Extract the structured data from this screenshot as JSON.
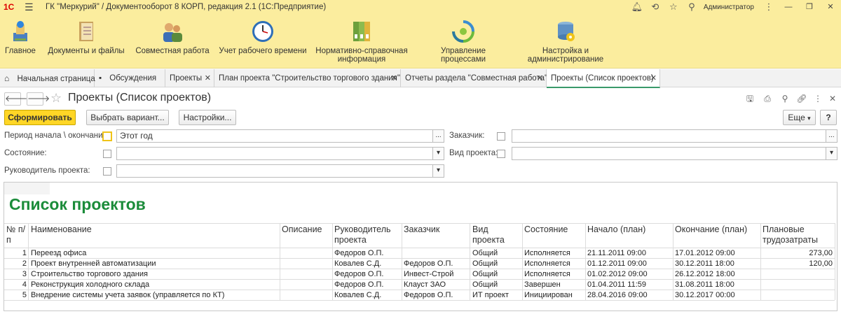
{
  "titlebar": {
    "logo": "1С",
    "title": "ГК \"Меркурий\" / Документооборот 8 КОРП, редакция 2.1  (1С:Предприятие)",
    "user": "Администратор",
    "icons": [
      "bell-icon",
      "history-icon",
      "star-icon",
      "search-icon",
      "dots-icon"
    ]
  },
  "sections": [
    {
      "label": "Главное",
      "icon": "home-icon"
    },
    {
      "label": "Документы и файлы",
      "icon": "documents-icon"
    },
    {
      "label": "Совместная работа",
      "icon": "people-icon"
    },
    {
      "label": "Учет рабочего времени",
      "icon": "clock-icon"
    },
    {
      "label": "Нормативно-справочная информация",
      "icon": "binders-icon"
    },
    {
      "label": "Управление процессами",
      "icon": "process-icon"
    },
    {
      "label": "Настройка и администрирование",
      "icon": "settings-db-icon"
    }
  ],
  "tabs": [
    {
      "label": "Начальная страница",
      "closable": false
    },
    {
      "label": "Обсуждения",
      "closable": false
    },
    {
      "label": "Проекты",
      "closable": true
    },
    {
      "label": "План проекта \"Строительство торгового здания\"",
      "closable": true
    },
    {
      "label": "Отчеты раздела \"Совместная работа\"",
      "closable": true
    },
    {
      "label": "Проекты (Список проектов)",
      "closable": true,
      "active": true
    }
  ],
  "form": {
    "title": "Проекты (Список проектов)",
    "generate_label": "Сформировать",
    "choose_variant_label": "Выбрать вариант...",
    "settings_label": "Настройки...",
    "more_label": "Еще",
    "help_label": "?"
  },
  "filters": {
    "period_label": "Период начала \\ окончания:",
    "period_value": "Этот год",
    "state_label": "Состояние:",
    "manager_label": "Руководитель проекта:",
    "customer_label": "Заказчик:",
    "project_type_label": "Вид проекта:",
    "ellipsis": "...",
    "dropdown": "▾"
  },
  "report": {
    "title": "Список проектов",
    "columns": [
      "№ п/п",
      "Наименование",
      "Описание",
      "Руководитель проекта",
      "Заказчик",
      "Вид проекта",
      "Состояние",
      "Начало (план)",
      "Окончание (план)",
      "Плановые трудозатраты"
    ],
    "rows": [
      {
        "n": "1",
        "name": "Переезд офиса",
        "desc": "",
        "manager": "Федоров О.П.",
        "customer": "",
        "type": "Общий",
        "state": "Исполняется",
        "start": "21.11.2011 09:00",
        "end": "17.01.2012 09:00",
        "effort": "273,00"
      },
      {
        "n": "2",
        "name": "Проект внутренней автоматизации",
        "desc": "",
        "manager": "Ковалев С.Д.",
        "customer": "Федоров О.П.",
        "type": "Общий",
        "state": "Исполняется",
        "start": "01.12.2011 09:00",
        "end": "30.12.2011 18:00",
        "effort": "120,00"
      },
      {
        "n": "3",
        "name": "Строительство торгового здания",
        "desc": "",
        "manager": "Федоров О.П.",
        "customer": "Инвест-Строй",
        "type": "Общий",
        "state": "Исполняется",
        "start": "01.02.2012 09:00",
        "end": "26.12.2012 18:00",
        "effort": ""
      },
      {
        "n": "4",
        "name": "Реконструкция холодного склада",
        "desc": "",
        "manager": "Федоров О.П.",
        "customer": "Клауст ЗАО",
        "type": "Общий",
        "state": "Завершен",
        "start": "01.04.2011 11:59",
        "end": "31.08.2011 18:00",
        "effort": ""
      },
      {
        "n": "5",
        "name": "Внедрение системы учета заявок (управляется по КТ)",
        "desc": "",
        "manager": "Ковалев С.Д.",
        "customer": "Федоров О.П.",
        "type": "ИТ проект",
        "state": "Инициирован",
        "start": "28.04.2016 09:00",
        "end": "30.12.2017 00:00",
        "effort": ""
      }
    ]
  }
}
